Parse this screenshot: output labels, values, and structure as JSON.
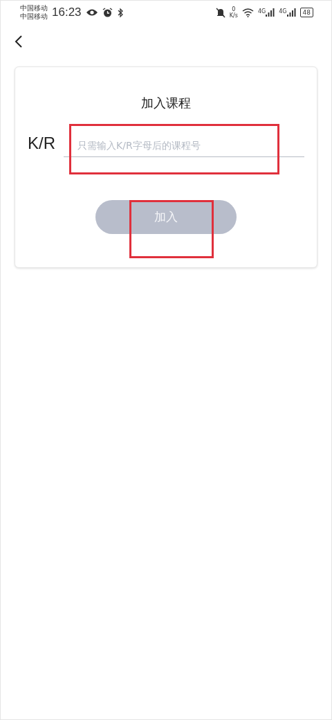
{
  "status_bar": {
    "carriers": [
      "中国移动",
      "中国移动"
    ],
    "time": "16:23",
    "speed_value": "0",
    "speed_unit": "K/s",
    "network_labels": [
      "4G",
      "4G"
    ],
    "battery": "48"
  },
  "card": {
    "title": "加入课程",
    "code_field": {
      "label": "K/R",
      "placeholder": "只需输入K/R字母后的课程号",
      "highlighted": true
    },
    "join_button": {
      "label": "加入",
      "disabled": true,
      "highlighted": true
    }
  }
}
